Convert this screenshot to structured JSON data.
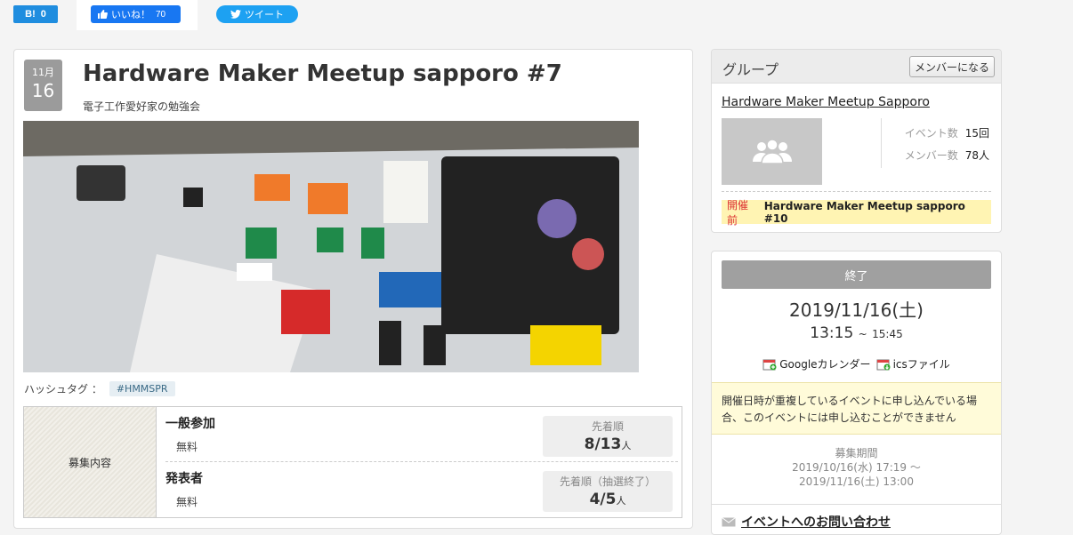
{
  "social": {
    "hatena_label": "B!",
    "hatena_count": "0",
    "fb_label": "いいね！",
    "fb_count": "70",
    "tweet_label": "ツイート"
  },
  "event": {
    "month": "11月",
    "day": "16",
    "title": "Hardware Maker Meetup sapporo #7",
    "subtitle": "電子工作愛好家の勉強会",
    "hashtag_label": "ハッシュタグ ：",
    "hashtag": "#HMMSPR"
  },
  "recruit": {
    "label": "募集内容",
    "rows": [
      {
        "name": "一般参加",
        "fee": "無料",
        "method": "先着順",
        "count": "8/13",
        "unit": "人"
      },
      {
        "name": "発表者",
        "fee": "無料",
        "method": "先着順（抽選終了）",
        "count": "4/5",
        "unit": "人"
      }
    ]
  },
  "group": {
    "header": "グループ",
    "join_button": "メンバーになる",
    "name": "Hardware Maker Meetup Sapporo",
    "events_label": "イベント数",
    "events_value": "15回",
    "members_label": "メンバー数",
    "members_value": "78人",
    "next_badge": "開催前",
    "next_event": "Hardware Maker Meetup sapporo #10"
  },
  "schedule": {
    "status": "終了",
    "date": "2019/11/16(土)",
    "start": "13:15",
    "sep": "~",
    "end": "15:45",
    "google_cal": "Googleカレンダー",
    "ics": "icsファイル",
    "warning": "開催日時が重複しているイベントに申し込んでいる場合、このイベントには申し込むことができません",
    "period_label": "募集期間",
    "period_start": "2019/10/16(水) 17:19 〜",
    "period_end": "2019/11/16(土) 13:00",
    "contact": "イベントへのお問い合わせ"
  }
}
